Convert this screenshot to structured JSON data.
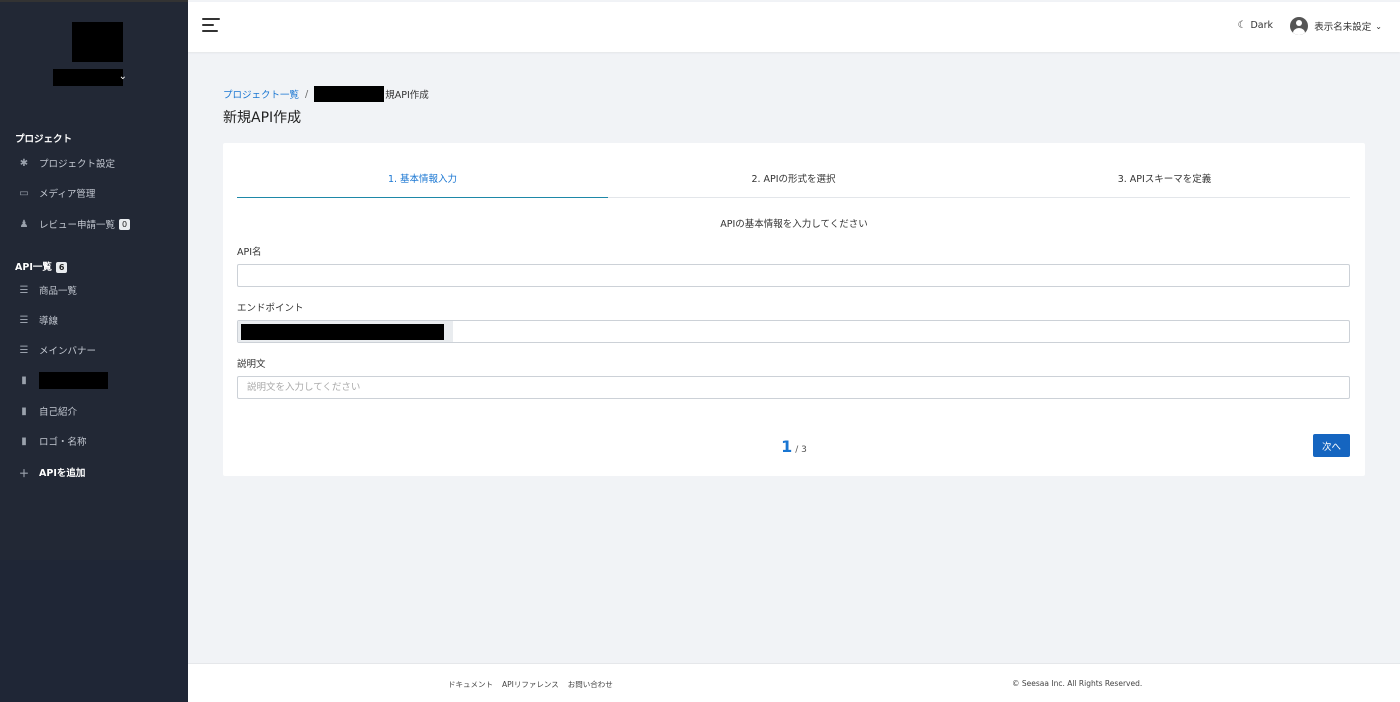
{
  "header": {
    "dark_label": "Dark",
    "user_name": "表示名未設定"
  },
  "sidebar": {
    "project_heading": "プロジェクト",
    "project_items": [
      {
        "label": "プロジェクト設定",
        "icon": "gear-icon"
      },
      {
        "label": "メディア管理",
        "icon": "media-icon"
      },
      {
        "label": "レビュー申請一覧",
        "icon": "review-icon",
        "badge": "0"
      }
    ],
    "api_heading": "API一覧",
    "api_count": "6",
    "api_items": [
      {
        "label": "商品一覧",
        "icon": "list-icon"
      },
      {
        "label": "導線",
        "icon": "list-icon"
      },
      {
        "label": "メインバナー",
        "icon": "list-icon"
      },
      {
        "label": "自己紹介",
        "icon": "document-icon"
      },
      {
        "label": "ロゴ・名称",
        "icon": "document-icon"
      }
    ],
    "add_api_label": "APIを追加"
  },
  "breadcrumb": {
    "root": "プロジェクト一覧",
    "separator": "/",
    "current": "規API作成"
  },
  "page": {
    "title": "新規API作成"
  },
  "wizard": {
    "tabs": [
      "1. 基本情報入力",
      "2. APIの形式を選択",
      "3. APIスキーマを定義"
    ],
    "active_tab": 0,
    "caption": "APIの基本情報を入力してください",
    "fields": {
      "api_name_label": "API名",
      "api_name_value": "",
      "endpoint_label": "エンドポイント",
      "endpoint_value": "",
      "description_label": "説明文",
      "description_placeholder": "説明文を入力してください"
    },
    "pager": {
      "current": "1",
      "total": "/ 3"
    },
    "next_label": "次へ"
  },
  "footer": {
    "links": [
      "ドキュメント",
      "APIリファレンス",
      "お問い合わせ"
    ],
    "copyright": "© Seesaa Inc. All Rights Reserved."
  },
  "colors": {
    "sidebar_bg": "#222835",
    "accent": "#1976d2",
    "primary_button": "#1565c0"
  }
}
